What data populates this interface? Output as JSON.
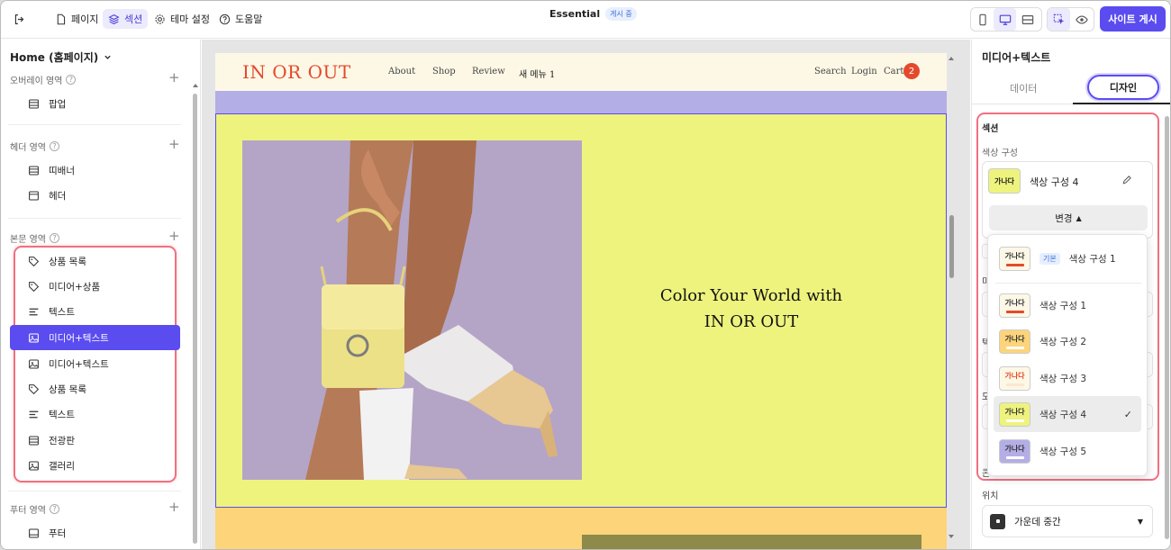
{
  "topbar": {
    "pages_label": "페이지",
    "section_label": "섹션",
    "theme_label": "테마 설정",
    "help_label": "도움말",
    "site_name": "Essential",
    "status_badge": "게시 중",
    "publish_label": "사이트 게시"
  },
  "left": {
    "page_selector": "Home (홈페이지)",
    "overlay": {
      "title": "오버레이 영역",
      "items": [
        "팝업"
      ]
    },
    "header": {
      "title": "헤더 영역",
      "items": [
        "띠배너",
        "헤더"
      ]
    },
    "body": {
      "title": "본문 영역",
      "items": [
        "상품 목록",
        "미디어+상품",
        "텍스트",
        "미디어+텍스트",
        "미디어+텍스트",
        "상품 목록",
        "텍스트",
        "전광판",
        "갤러리"
      ]
    },
    "footer": {
      "title": "푸터 영역",
      "items": [
        "푸터"
      ]
    }
  },
  "site": {
    "logo": "IN OR OUT",
    "nav": [
      "About",
      "Shop",
      "Review",
      "새 메뉴 1"
    ],
    "right_nav": [
      "Search",
      "Login",
      "Cart"
    ],
    "cart_count": "2",
    "headline_line1": "Color Your World with",
    "headline_line2": "IN OR OUT"
  },
  "right": {
    "title": "미디어+텍스트",
    "tab_data": "데이터",
    "tab_design": "디자인",
    "section_label": "섹션",
    "color_label": "색상 구성",
    "current_scheme": "색상 구성 4",
    "swatch_text": "가나다",
    "change_label": "변경",
    "default_badge": "기본",
    "schemes": [
      {
        "label": "색상 구성 1",
        "badge": true,
        "bg": "#fdf8e6",
        "bar": "#e4492c",
        "text": "#222"
      },
      {
        "label": "색상 구성 1",
        "badge": false,
        "bg": "#fdf8e6",
        "bar": "#e4492c",
        "text": "#222"
      },
      {
        "label": "색상 구성 2",
        "badge": false,
        "bg": "#fdd47a",
        "bar": "#ffffff",
        "text": "#222"
      },
      {
        "label": "색상 구성 3",
        "badge": false,
        "bg": "#fdf8e6",
        "bar": "#fde6d4",
        "text": "#e4492c"
      },
      {
        "label": "색상 구성 4",
        "badge": false,
        "bg": "#eef37e",
        "bar": "#ffffff",
        "text": "#222",
        "selected": true
      },
      {
        "label": "색상 구성 5",
        "badge": false,
        "bg": "#b3aee6",
        "bar": "#ffffff",
        "text": "#222"
      }
    ],
    "partial_labels": [
      "미",
      "텍",
      "도",
      "콘"
    ],
    "position_label": "위치",
    "position_value": "가운데 중간"
  },
  "colors": {
    "accent": "#5b4cf0",
    "highlight": "#f07080",
    "site_yellow": "#eef37e",
    "site_cream": "#fdf8e6",
    "brand_red": "#e4492c"
  }
}
